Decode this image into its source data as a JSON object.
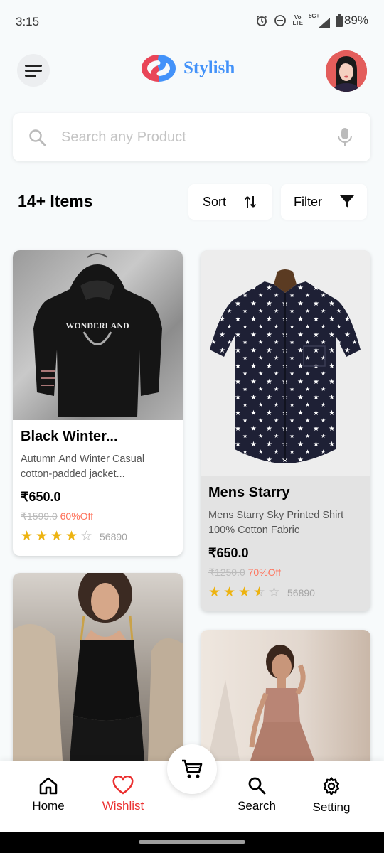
{
  "status_bar": {
    "time": "3:15",
    "volte_top": "Vo",
    "volte_bottom": "LTE",
    "network": "5G+",
    "battery": "89%"
  },
  "header": {
    "brand": "Stylish",
    "brand_color": "#4392F9",
    "menu_icon": "hamburger-icon",
    "avatar": "user-avatar"
  },
  "search": {
    "placeholder": "Search any Product",
    "value": ""
  },
  "toolbar": {
    "items_count": "14+ Items",
    "sort_label": "Sort",
    "filter_label": "Filter"
  },
  "products": [
    {
      "name": "Black Winter...",
      "description": "Autumn And Winter Casual cotton-padded jacket...",
      "price": "₹650.0",
      "original_price": "₹1599.0",
      "discount": "60%Off",
      "rating": 4,
      "rating_count": "56890"
    },
    {
      "name": "Mens Starry",
      "description": "Mens Starry Sky Printed Shirt 100% Cotton Fabric",
      "price": "₹650.0",
      "original_price": "₹1250.0",
      "discount": "70%Off",
      "rating": 3.5,
      "rating_count": "56890"
    },
    {
      "image": "black-dress-photo"
    },
    {
      "image": "pink-dress-photo"
    }
  ],
  "bottom_nav": {
    "home": "Home",
    "wishlist": "Wishlist",
    "search": "Search",
    "setting": "Setting",
    "active": "wishlist",
    "active_color": "#EB3030"
  }
}
